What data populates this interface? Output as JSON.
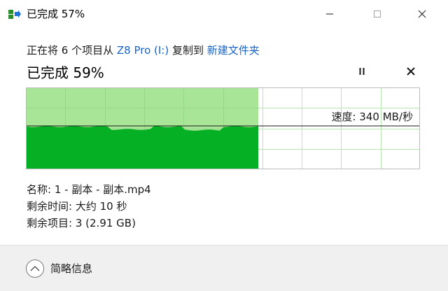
{
  "window": {
    "title": "已完成 57%",
    "minimize_icon": "minimize-icon",
    "maximize_icon": "maximize-icon",
    "close_icon": "close-icon"
  },
  "copy": {
    "prefix": "正在将 6 个项目从 ",
    "source": "Z8 Pro  (I:)",
    "middle": " 复制到 ",
    "destination": "新建文件夹",
    "progress_text": "已完成 59%",
    "progress": 0.59,
    "pause_icon": "pause-icon",
    "cancel_icon": "cancel-icon"
  },
  "graph": {
    "speed_label": "速度: 340 MB/秒",
    "fill_color": "#06b025",
    "light_fill_color": "#a8e596",
    "grid_color": "#b8e6b0"
  },
  "details": {
    "name": "名称: 1 - 副本 - 副本.mp4",
    "time_remaining": "剩余时间: 大约 10 秒",
    "items_remaining": "剩余项目: 3 (2.91 GB)"
  },
  "footer": {
    "toggle_icon": "chevron-up-icon",
    "label": "简略信息"
  }
}
